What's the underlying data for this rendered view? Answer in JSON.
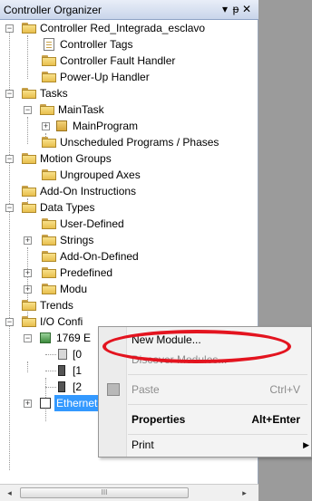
{
  "panel": {
    "title": "Controller Organizer",
    "title_buttons": [
      "▾",
      "ᵽ",
      "✕"
    ]
  },
  "tree": {
    "items": [
      {
        "label": "Controller Red_Integrada_esclavo",
        "icon": "folder-icon"
      },
      {
        "label": "Controller Tags",
        "icon": "tags-icon"
      },
      {
        "label": "Controller Fault Handler",
        "icon": "folder-icon"
      },
      {
        "label": "Power-Up Handler",
        "icon": "folder-icon"
      },
      {
        "label": "Tasks",
        "icon": "folder-icon"
      },
      {
        "label": "MainTask",
        "icon": "task-icon"
      },
      {
        "label": "MainProgram",
        "icon": "program-icon"
      },
      {
        "label": "Unscheduled Programs / Phases",
        "icon": "folder-icon"
      },
      {
        "label": "Motion Groups",
        "icon": "folder-icon"
      },
      {
        "label": "Ungrouped Axes",
        "icon": "folder-icon"
      },
      {
        "label": "Add-On Instructions",
        "icon": "folder-icon"
      },
      {
        "label": "Data Types",
        "icon": "folder-icon"
      },
      {
        "label": "User-Defined",
        "icon": "datatype-icon"
      },
      {
        "label": "Strings",
        "icon": "datatype-icon"
      },
      {
        "label": "Add-On-Defined",
        "icon": "datatype-icon"
      },
      {
        "label": "Predefined",
        "icon": "datatype-icon"
      },
      {
        "label": "Modu",
        "icon": "datatype-icon"
      },
      {
        "label": "Trends",
        "icon": "folder-icon"
      },
      {
        "label": "I/O Confi",
        "icon": "folder-icon"
      },
      {
        "label": "1769 E",
        "icon": "module-icon"
      },
      {
        "label": "[0",
        "icon": "slot-icon"
      },
      {
        "label": "[1",
        "icon": "slot-icon"
      },
      {
        "label": "[2",
        "icon": "slot-icon"
      },
      {
        "label": "Ethernet",
        "icon": "network-icon"
      }
    ]
  },
  "context_menu": {
    "items": [
      {
        "label": "New Module...",
        "shortcut": ""
      },
      {
        "label": "Discover Modules...",
        "shortcut": ""
      },
      {
        "label": "Paste",
        "shortcut": "Ctrl+V"
      },
      {
        "label": "Properties",
        "shortcut": "Alt+Enter"
      },
      {
        "label": "Print",
        "shortcut": ""
      }
    ]
  },
  "scrollbar": {
    "left": "◂",
    "thumb": "III",
    "right": "▸"
  },
  "colors": {
    "selection": "#3399ff",
    "highlight_ring": "#e3141f"
  }
}
